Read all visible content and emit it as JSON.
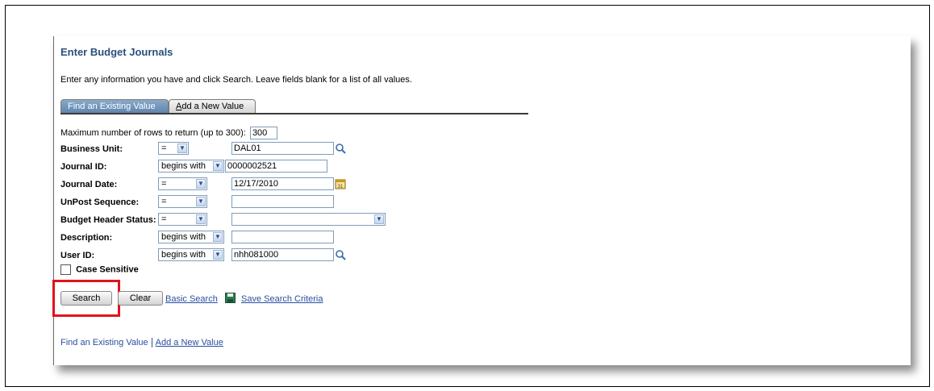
{
  "page": {
    "title": "Enter Budget Journals",
    "instructions": "Enter any information you have and click Search. Leave fields blank for a list of all values."
  },
  "tabs": {
    "active": "Find an Existing Value",
    "inactive_first_letter": "A",
    "inactive_rest": "dd a New Value"
  },
  "max_rows": {
    "label": "Maximum number of rows to return (up to 300):",
    "value": "300"
  },
  "fields": {
    "business_unit": {
      "label": "Business Unit:",
      "operator": "=",
      "value": "DAL01"
    },
    "journal_id": {
      "label": "Journal ID:",
      "operator": "begins with",
      "value": "0000002521"
    },
    "journal_date": {
      "label": "Journal Date:",
      "operator": "=",
      "value": "12/17/2010"
    },
    "unpost_sequence": {
      "label": "UnPost Sequence:",
      "operator": "=",
      "value": ""
    },
    "budget_header_status": {
      "label": "Budget Header Status:",
      "operator": "=",
      "value": ""
    },
    "description": {
      "label": "Description:",
      "operator": "begins with",
      "value": ""
    },
    "user_id": {
      "label": "User ID:",
      "operator": "begins with",
      "value": "nhh081000"
    }
  },
  "case_sensitive": {
    "label": "Case Sensitive",
    "checked": false
  },
  "buttons": {
    "search": "Search",
    "clear": "Clear"
  },
  "links": {
    "basic_search": "Basic Search",
    "save_search_criteria": "Save Search Criteria",
    "find_existing": "Find an Existing Value",
    "add_new": "Add a New Value"
  },
  "icons": {
    "lookup": "magnifier-icon",
    "calendar": "calendar-icon",
    "save": "floppy-disk-icon",
    "dropdown": "chevron-down-icon"
  },
  "colors": {
    "title": "#2a4f7f",
    "link": "#2a4f9c",
    "active_tab": "#6f93b9",
    "highlight": "#e0141c"
  }
}
